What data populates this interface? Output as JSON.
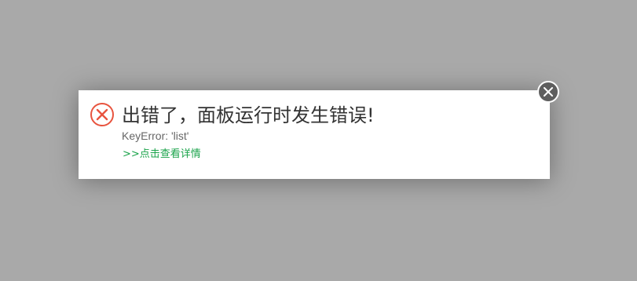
{
  "dialog": {
    "title": "出错了，面板运行时发生错误!",
    "message": "KeyError: 'list'",
    "details_link": ">>点击查看详情",
    "icon": "error-circle-x-icon",
    "close_icon": "close-icon"
  },
  "colors": {
    "overlay": "#a9a9a9",
    "error_icon": "#e8543f",
    "link": "#1aa34a",
    "close_button": "#5f5f5f"
  }
}
